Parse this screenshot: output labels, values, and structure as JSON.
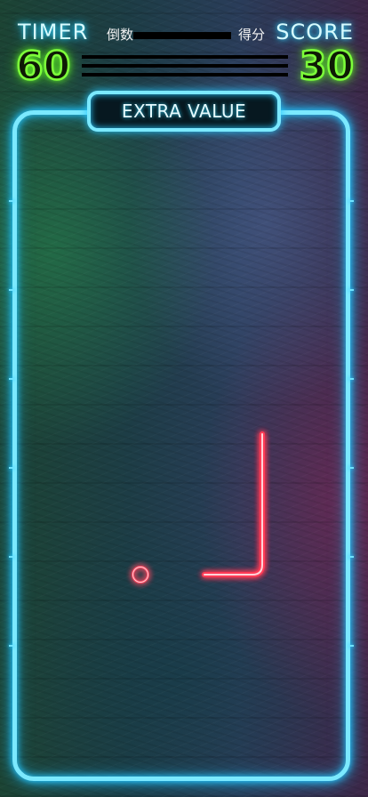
{
  "hud": {
    "timer_label": "TIMER",
    "timer_sub": "倒数",
    "timer_value": "60",
    "score_label": "SCORE",
    "score_sub": "得分",
    "score_value": "30"
  },
  "banner": {
    "text": "EXTRA VALUE"
  },
  "colors": {
    "frame_neon": "#7be9ff",
    "hud_green": "#7dff3a",
    "piece_red": "#ff3a55"
  },
  "pieces": {
    "ball": "red-neon-ring",
    "shape": "red-neon-l-shape"
  }
}
